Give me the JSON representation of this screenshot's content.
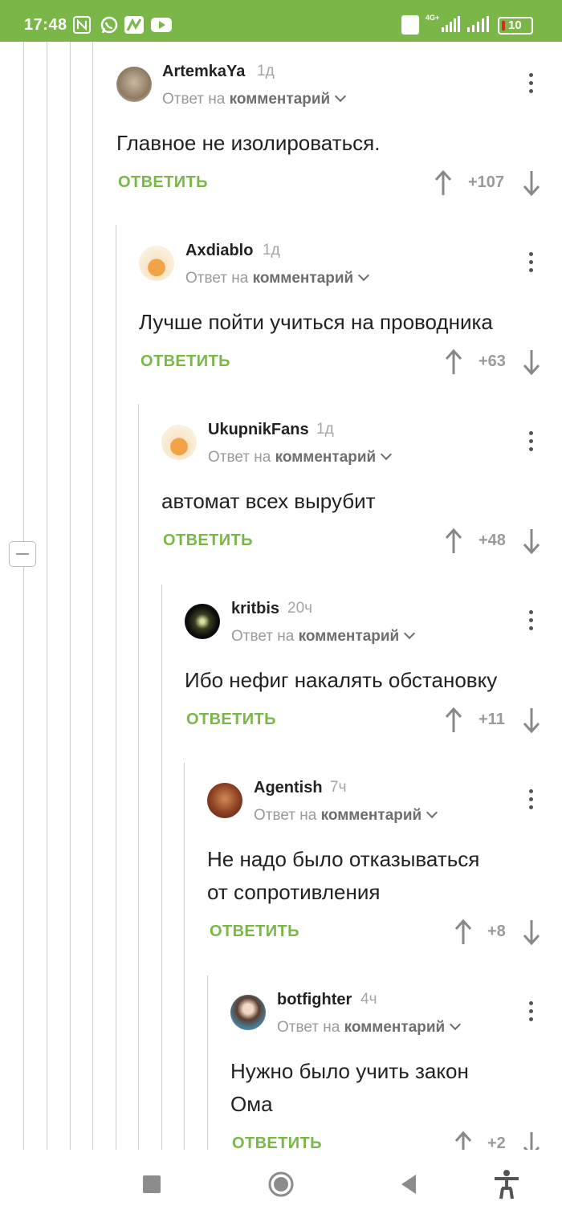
{
  "status_bar": {
    "time": "17:48",
    "battery": "10",
    "network": "4G+"
  },
  "collapse_symbol": "−",
  "comments": [
    {
      "author": "ArtemkaYa",
      "age": "1д",
      "reply_prefix": "Ответ на",
      "reply_target": "комментарий",
      "text": "Главное не изолироваться.",
      "reply_label": "ОТВЕТИТЬ",
      "score": "+107"
    },
    {
      "author": "Axdiablo",
      "age": "1д",
      "reply_prefix": "Ответ на",
      "reply_target": "комментарий",
      "text": "Лучше пойти учиться на проводника",
      "reply_label": "ОТВЕТИТЬ",
      "score": "+63"
    },
    {
      "author": "UkupnikFans",
      "age": "1д",
      "reply_prefix": "Ответ на",
      "reply_target": "комментарий",
      "text": "автомат всех вырубит",
      "reply_label": "ОТВЕТИТЬ",
      "score": "+48"
    },
    {
      "author": "kritbis",
      "age": "20ч",
      "reply_prefix": "Ответ на",
      "reply_target": "комментарий",
      "text": "Ибо нефиг накалять обстановку",
      "reply_label": "ОТВЕТИТЬ",
      "score": "+11"
    },
    {
      "author": "Agentish",
      "age": "7ч",
      "reply_prefix": "Ответ на",
      "reply_target": "комментарий",
      "text_lines": [
        "Не надо было отказываться",
        "от сопротивления"
      ],
      "reply_label": "ОТВЕТИТЬ",
      "score": "+8"
    },
    {
      "author": "botfighter",
      "age": "4ч",
      "reply_prefix": "Ответ на",
      "reply_target": "комментарий",
      "text_lines": [
        "Нужно было учить закон",
        "Ома"
      ],
      "reply_label": "ОТВЕТИТЬ",
      "score": "+2"
    }
  ],
  "colors": {
    "accent": "#7ab648",
    "status_bar": "#7ab648"
  }
}
